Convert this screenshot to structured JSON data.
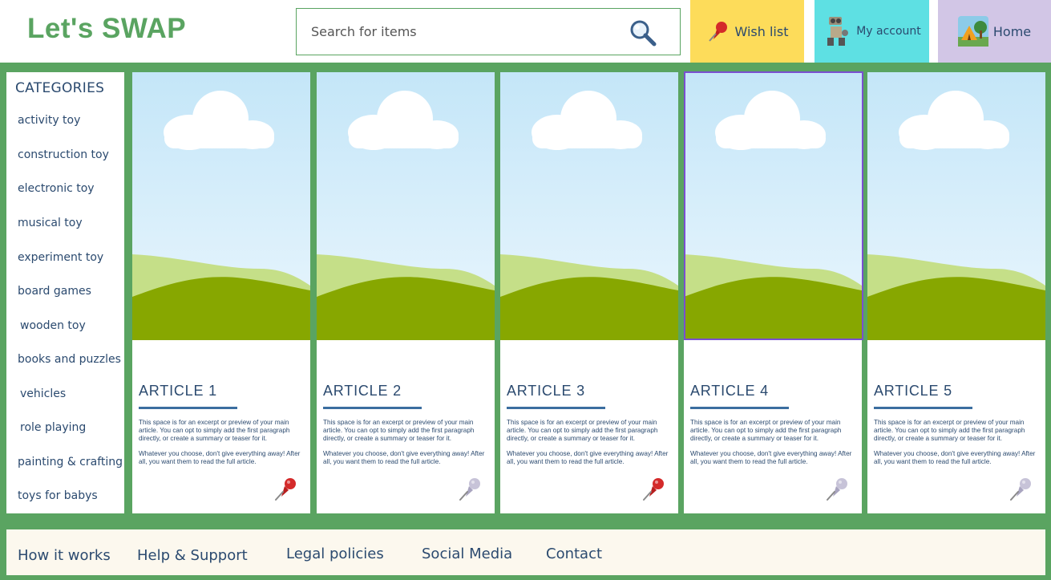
{
  "header": {
    "logo": "Let's SWAP",
    "search_placeholder": "Search for items",
    "wish_list": "Wish list",
    "my_account": "My account",
    "home": "Home"
  },
  "sidebar": {
    "title": "CATEGORIES",
    "items": [
      "activity toy",
      "construction toy",
      "electronic toy",
      "musical toy",
      "experiment toy",
      "board games",
      "wooden toy",
      "books and puzzles",
      "vehicles",
      "role playing",
      "painting & crafting",
      "toys for babys"
    ]
  },
  "articles": [
    {
      "title": "ARTICLE 1",
      "para1": "This space is for an excerpt or preview of your main article. You can opt to simply add the first paragraph directly, or create a summary or teaser for it.",
      "para2": "Whatever you choose, don't give everything away! After all, you want them to read the full article.",
      "pin": "red-pin-icon"
    },
    {
      "title": "ARTICLE 2",
      "para1": "This space is for an excerpt or preview of your main article. You can opt to simply add the first paragraph directly, or create a summary or teaser for it.",
      "para2": "Whatever you choose, don't give everything away! After all, you want them to read the full article.",
      "pin": "grey-pin-icon"
    },
    {
      "title": "ARTICLE 3",
      "para1": "This space is for an excerpt or preview of your main article. You can opt to simply add the first paragraph directly, or create a summary or teaser for it.",
      "para2": "Whatever you choose, don't give everything away! After all, you want them to read the full article.",
      "pin": "red-pin-icon"
    },
    {
      "title": "ARTICLE 4",
      "para1": "This space is for an excerpt or preview of your main article. You can opt to simply add the first paragraph directly, or create a summary or teaser for it.",
      "para2": "Whatever you choose, don't give everything away! After all, you want them to read the full article.",
      "pin": "grey-pin-icon"
    },
    {
      "title": "ARTICLE 5",
      "para1": "This space is for an excerpt or preview of your main article. You can opt to simply add the first paragraph directly, or create a summary or teaser for it.",
      "para2": "Whatever you choose, don't give everything away! After all, you want them to read the full article.",
      "pin": "grey-pin-icon"
    }
  ],
  "footer": {
    "links": [
      "How it works",
      "Help & Support",
      "Legal policies",
      "Social Media",
      "Contact"
    ]
  },
  "colors": {
    "brand_green": "#5aa461",
    "wish_yellow": "#fddc5a",
    "account_cyan": "#5ee0e3",
    "home_lavender": "#d2c6e6",
    "text_navy": "#2b4a6f",
    "selected_border": "#7a4fd0"
  }
}
